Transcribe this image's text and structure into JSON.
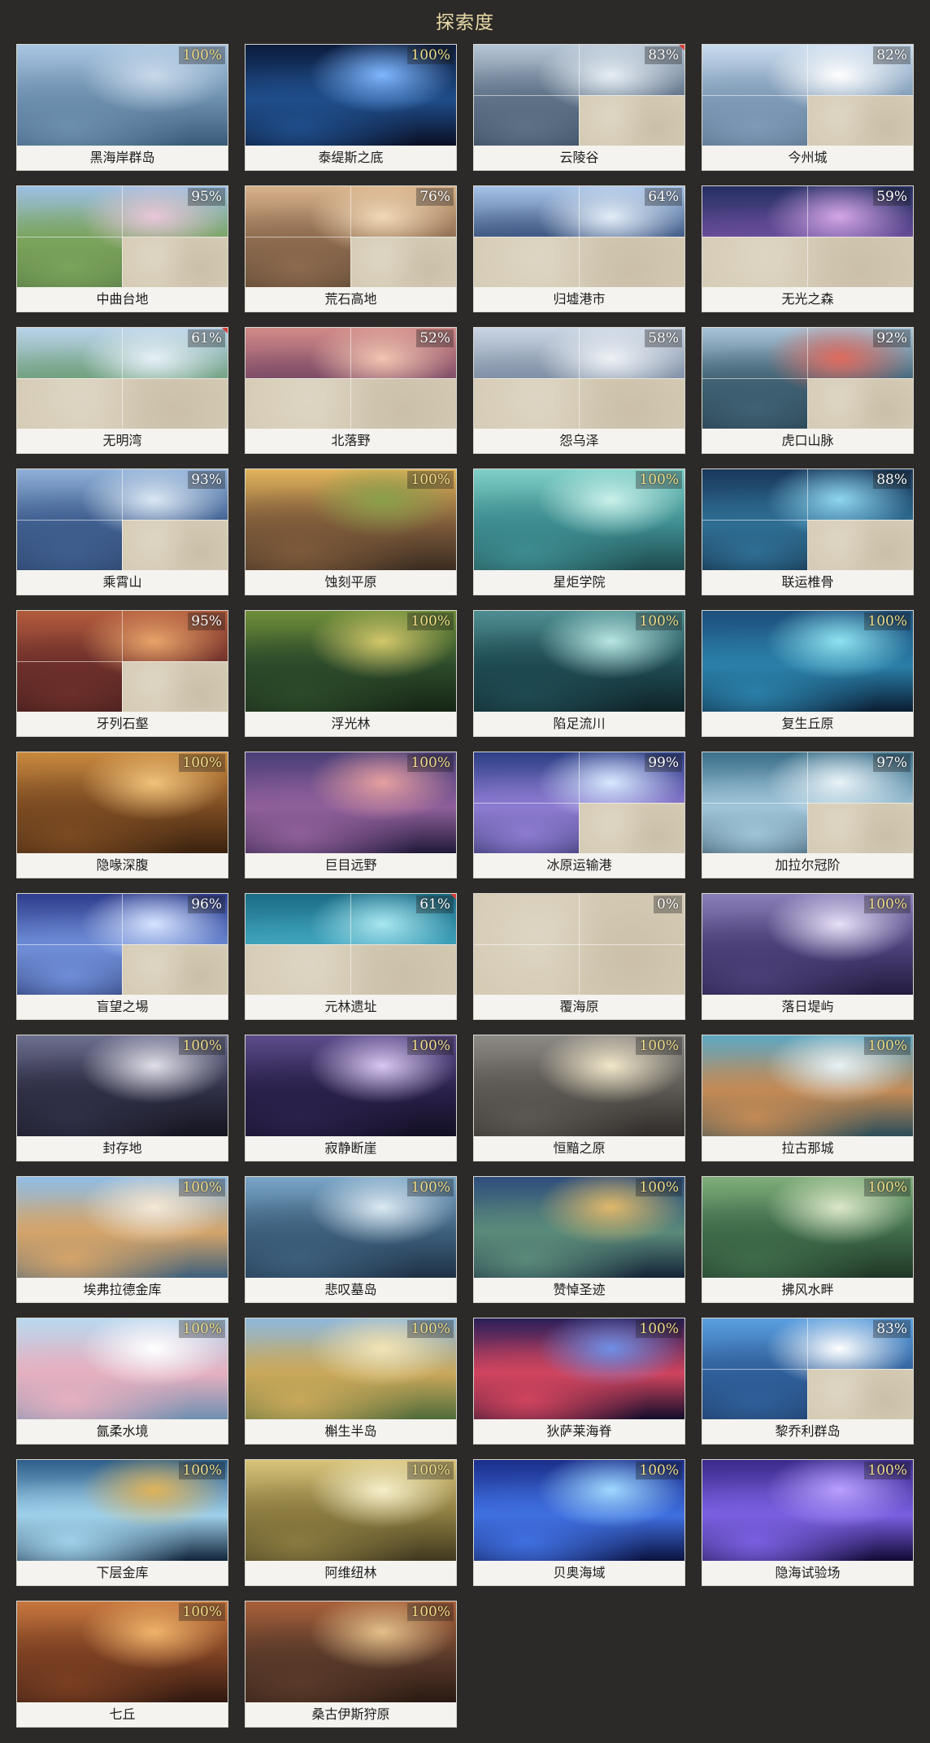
{
  "page": {
    "title": "探索度"
  },
  "regions": [
    {
      "name": "黑海岸群岛",
      "percent": "100%",
      "fog": "none",
      "flag": false,
      "palette": [
        "#a9c6e2",
        "#6d8fae",
        "#c8d9ea",
        "#3a5a79"
      ]
    },
    {
      "name": "泰缇斯之底",
      "percent": "100%",
      "fog": "none",
      "flag": false,
      "palette": [
        "#0c1c3d",
        "#1f4d8a",
        "#7fb7ff",
        "#0a0f24"
      ]
    },
    {
      "name": "云陵谷",
      "percent": "83%",
      "fog": "bottom-right",
      "flag": true,
      "palette": [
        "#b7c6d6",
        "#5e7187",
        "#e6eef4",
        "#2f3f52"
      ]
    },
    {
      "name": "今州城",
      "percent": "82%",
      "fog": "bottom-right",
      "flag": false,
      "palette": [
        "#c9dbee",
        "#7e9ab6",
        "#ffffff",
        "#4d6680"
      ]
    },
    {
      "name": "中曲台地",
      "percent": "95%",
      "fog": "bottom-right",
      "flag": false,
      "palette": [
        "#9dc0e4",
        "#7aa35b",
        "#e8c6d8",
        "#4c6d3e"
      ]
    },
    {
      "name": "荒石高地",
      "percent": "76%",
      "fog": "right-bottom",
      "flag": false,
      "palette": [
        "#d8b28a",
        "#8c6a4e",
        "#f1d8b6",
        "#4a3829"
      ]
    },
    {
      "name": "归墟港市",
      "percent": "64%",
      "fog": "bottom",
      "flag": false,
      "palette": [
        "#a8c4e8",
        "#3c5580",
        "#e2ecf7",
        "#22324f"
      ]
    },
    {
      "name": "无光之森",
      "percent": "59%",
      "fog": "bottom",
      "flag": false,
      "palette": [
        "#253064",
        "#6b4e9c",
        "#d4a6e6",
        "#121636"
      ]
    },
    {
      "name": "无明湾",
      "percent": "61%",
      "fog": "bottom",
      "flag": true,
      "palette": [
        "#b9d3ea",
        "#6f9f7c",
        "#e6f0f7",
        "#3f6b5a"
      ]
    },
    {
      "name": "北落野",
      "percent": "52%",
      "fog": "bottom",
      "flag": false,
      "palette": [
        "#d28a88",
        "#7b4a66",
        "#f1c4b1",
        "#3b2637"
      ]
    },
    {
      "name": "怨乌泽",
      "percent": "58%",
      "fog": "bottom",
      "flag": false,
      "palette": [
        "#c9d4e3",
        "#7d8da3",
        "#eef2f6",
        "#46556b"
      ]
    },
    {
      "name": "虎口山脉",
      "percent": "92%",
      "fog": "bottom-right",
      "flag": false,
      "palette": [
        "#a9c4d8",
        "#3f6173",
        "#e06b5e",
        "#1f3442"
      ]
    },
    {
      "name": "乘霄山",
      "percent": "93%",
      "fog": "bottom-right",
      "flag": false,
      "palette": [
        "#8fb0d8",
        "#3f5e8f",
        "#dbe8f4",
        "#263a5c"
      ]
    },
    {
      "name": "蚀刻平原",
      "percent": "100%",
      "fog": "none",
      "flag": false,
      "palette": [
        "#e2b45b",
        "#7d5a3a",
        "#8aa04a",
        "#3a2c21"
      ]
    },
    {
      "name": "星炬学院",
      "percent": "100%",
      "fog": "none",
      "flag": false,
      "palette": [
        "#7fd0c8",
        "#3d8c8f",
        "#c9f1ea",
        "#1e4a4e"
      ]
    },
    {
      "name": "联运椎骨",
      "percent": "88%",
      "fog": "bottom-right",
      "flag": false,
      "palette": [
        "#19385a",
        "#2f6e94",
        "#8fd6f0",
        "#0c1a2b"
      ]
    },
    {
      "name": "牙列石壑",
      "percent": "95%",
      "fog": "bottom-right",
      "flag": false,
      "palette": [
        "#b35c3d",
        "#6d2f2a",
        "#e8a36a",
        "#2f1717"
      ]
    },
    {
      "name": "浮光林",
      "percent": "100%",
      "fog": "none",
      "flag": false,
      "palette": [
        "#6f8f3a",
        "#2c4a2a",
        "#d2c76a",
        "#162515"
      ]
    },
    {
      "name": "陷足流川",
      "percent": "100%",
      "fog": "none",
      "flag": false,
      "palette": [
        "#4e8f92",
        "#1f4a52",
        "#b8e6e2",
        "#0f2328"
      ]
    },
    {
      "name": "复生丘原",
      "percent": "100%",
      "fog": "none",
      "flag": false,
      "palette": [
        "#1d4f7c",
        "#2a7fa8",
        "#8fe3f0",
        "#0b1d33"
      ]
    },
    {
      "name": "隐喙深腹",
      "percent": "100%",
      "fog": "none",
      "flag": false,
      "palette": [
        "#c9893e",
        "#7b4b22",
        "#f0c27a",
        "#3a220f"
      ]
    },
    {
      "name": "巨目远野",
      "percent": "100%",
      "fog": "none",
      "flag": false,
      "palette": [
        "#4a3f78",
        "#8f5f9a",
        "#e6a0a0",
        "#201a3a"
      ]
    },
    {
      "name": "冰原运输港",
      "percent": "99%",
      "fog": "bottom-right",
      "flag": false,
      "palette": [
        "#2d3f86",
        "#8d7bd1",
        "#d8e9ff",
        "#141c45"
      ]
    },
    {
      "name": "加拉尔冠阶",
      "percent": "97%",
      "fog": "bottom-right",
      "flag": false,
      "palette": [
        "#3b6f8a",
        "#9fc4d8",
        "#e9f3f8",
        "#1b3545"
      ]
    },
    {
      "name": "盲望之埸",
      "percent": "96%",
      "fog": "bottom-right",
      "flag": false,
      "palette": [
        "#2f3d8d",
        "#6f8ed8",
        "#d6e4ff",
        "#151d4a"
      ]
    },
    {
      "name": "元林遗址",
      "percent": "61%",
      "fog": "bottom",
      "flag": true,
      "palette": [
        "#1c6c86",
        "#41a6bf",
        "#a9e7f0",
        "#0d2f3a"
      ]
    },
    {
      "name": "覆海原",
      "percent": "0%",
      "fog": "all",
      "flag": false,
      "palette": [
        "#d6ccb6",
        "#d6ccb6",
        "#d6ccb6",
        "#d6ccb6"
      ]
    },
    {
      "name": "落日堤屿",
      "percent": "100%",
      "fog": "none",
      "flag": false,
      "palette": [
        "#8a7fb8",
        "#4b3f78",
        "#e7e0f7",
        "#241c3f"
      ]
    },
    {
      "name": "封存地",
      "percent": "100%",
      "fog": "none",
      "flag": false,
      "palette": [
        "#6d6f8f",
        "#2f2f46",
        "#e0dfe8",
        "#15151f"
      ]
    },
    {
      "name": "寂静断崖",
      "percent": "100%",
      "fog": "none",
      "flag": false,
      "palette": [
        "#5c4b8a",
        "#2a214b",
        "#d8c7f2",
        "#130f24"
      ]
    },
    {
      "name": "恒黯之原",
      "percent": "100%",
      "fog": "none",
      "flag": false,
      "palette": [
        "#8d8a86",
        "#5b5752",
        "#f1e7c9",
        "#2f2c29"
      ]
    },
    {
      "name": "拉古那城",
      "percent": "100%",
      "fog": "none",
      "flag": false,
      "palette": [
        "#5ea7c4",
        "#c28a55",
        "#e8f1f4",
        "#2a4d5a"
      ]
    },
    {
      "name": "埃弗拉德金库",
      "percent": "100%",
      "fog": "none",
      "flag": false,
      "palette": [
        "#8fbde6",
        "#d4a46a",
        "#f4e8d6",
        "#3c5f7c"
      ]
    },
    {
      "name": "悲叹墓岛",
      "percent": "100%",
      "fog": "none",
      "flag": false,
      "palette": [
        "#7aa6c8",
        "#3d5f7c",
        "#dbe9f3",
        "#1e3145"
      ]
    },
    {
      "name": "赞悼圣迹",
      "percent": "100%",
      "fog": "none",
      "flag": false,
      "palette": [
        "#2e4e7c",
        "#5a8a7a",
        "#e0b86a",
        "#142338"
      ]
    },
    {
      "name": "拂风水畔",
      "percent": "100%",
      "fog": "none",
      "flag": false,
      "palette": [
        "#7fae7a",
        "#3f6b4a",
        "#dbe8c8",
        "#1f3626"
      ]
    },
    {
      "name": "氤柔水境",
      "percent": "100%",
      "fog": "none",
      "flag": false,
      "palette": [
        "#b9d9f0",
        "#e5b0c0",
        "#ffffff",
        "#6f8fb0"
      ]
    },
    {
      "name": "槲生半岛",
      "percent": "100%",
      "fog": "none",
      "flag": false,
      "palette": [
        "#8fb8dc",
        "#c9a85a",
        "#f2e4b6",
        "#4f6b3a"
      ]
    },
    {
      "name": "狄萨莱海脊",
      "percent": "100%",
      "fog": "none",
      "flag": false,
      "palette": [
        "#2a1f5a",
        "#d0445e",
        "#6f8fe6",
        "#120d2b"
      ]
    },
    {
      "name": "黎乔利群岛",
      "percent": "83%",
      "fog": "bottom-right",
      "flag": false,
      "palette": [
        "#5a9fe0",
        "#2f5f9a",
        "#ffffff",
        "#1a3356"
      ]
    },
    {
      "name": "下层金库",
      "percent": "100%",
      "fog": "none",
      "flag": false,
      "palette": [
        "#2b5d8a",
        "#9fd0ea",
        "#e0b45a",
        "#10243a"
      ]
    },
    {
      "name": "阿维纽林",
      "percent": "100%",
      "fog": "none",
      "flag": false,
      "palette": [
        "#d8c47a",
        "#8a7a3f",
        "#f6efc9",
        "#3f3820"
      ]
    },
    {
      "name": "贝奥海域",
      "percent": "100%",
      "fog": "none",
      "flag": false,
      "palette": [
        "#1b2f8a",
        "#3f6fe0",
        "#9fd8ff",
        "#0b1240"
      ]
    },
    {
      "name": "隐海试验场",
      "percent": "100%",
      "fog": "none",
      "flag": false,
      "palette": [
        "#3b2a8a",
        "#7a5fe0",
        "#b8a0ff",
        "#120a36"
      ]
    },
    {
      "name": "七丘",
      "percent": "100%",
      "fog": "none",
      "flag": false,
      "palette": [
        "#c7773e",
        "#7a3f22",
        "#f0b36a",
        "#2f1810"
      ]
    },
    {
      "name": "桑古伊斯狩原",
      "percent": "100%",
      "fog": "none",
      "flag": false,
      "palette": [
        "#a8603a",
        "#5a3a2a",
        "#e3c08a",
        "#2a1a12"
      ]
    }
  ]
}
